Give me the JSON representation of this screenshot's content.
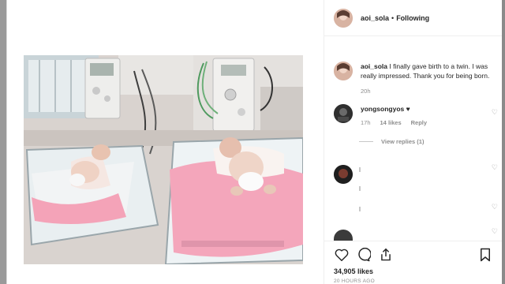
{
  "header": {
    "username": "aoi_sola",
    "separator": "•",
    "follow_label": "Following"
  },
  "caption": {
    "username": "aoi_sola",
    "text": "I finally gave birth to a twin. I was really impressed. Thank you for being born.",
    "time": "20h"
  },
  "comments": [
    {
      "username": "yongsongyos",
      "text": "♥",
      "time": "17h",
      "likes": "14 likes",
      "reply_label": "Reply"
    }
  ],
  "view_replies": "View replies (1)",
  "footer": {
    "likes": "34,905 likes",
    "posted": "20 HOURS AGO"
  },
  "icons": {
    "like": "heart-icon",
    "comment": "comment-icon",
    "share": "share-icon",
    "save": "bookmark-icon"
  },
  "colors": {
    "text": "#262626",
    "muted": "#8e8e8e",
    "border": "#efefef"
  }
}
